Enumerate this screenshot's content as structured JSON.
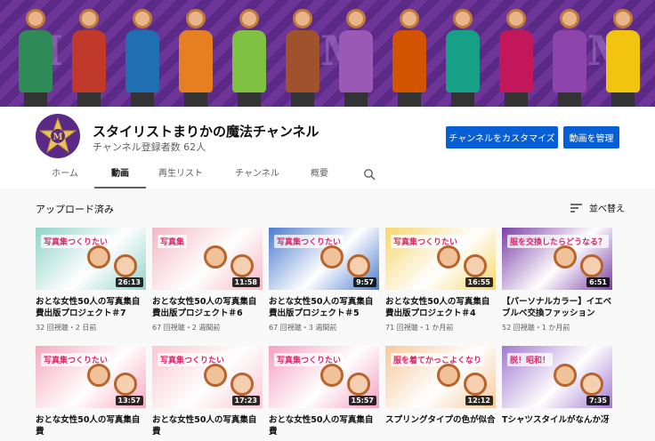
{
  "channel": {
    "name": "スタイリストまりかの魔法チャンネル",
    "subscribers": "チャンネル登録者数 62人",
    "buttons": {
      "customize": "チャンネルをカスタマイズ",
      "manage": "動画を管理"
    }
  },
  "tabs": [
    {
      "label": "ホーム",
      "active": false
    },
    {
      "label": "動画",
      "active": true
    },
    {
      "label": "再生リスト",
      "active": false
    },
    {
      "label": "チャンネル",
      "active": false
    },
    {
      "label": "概要",
      "active": false
    }
  ],
  "section": {
    "title": "アップロード済み",
    "sort_label": "並べ替え"
  },
  "videos": [
    {
      "title": "おとな女性50人の写真集自費出版プロジェクト＃7",
      "meta": "32 回視聴・2 日前",
      "duration": "26:13",
      "thumb_text": "写真集つくりたい",
      "color": "#8fd4c8"
    },
    {
      "title": "おとな女性50人の写真集自費出版プロジェクト＃6",
      "meta": "67 回視聴・2 週間前",
      "duration": "11:58",
      "thumb_text": "写真集",
      "color": "#f4b7c4"
    },
    {
      "title": "おとな女性50人の写真集自費出版プロジェクト＃5",
      "meta": "67 回視聴・3 週間前",
      "duration": "9:57",
      "thumb_text": "写真集つくりたい",
      "color": "#4c7bd0"
    },
    {
      "title": "おとな女性50人の写真集自費出版プロジェクト＃4",
      "meta": "71 回視聴・1 か月前",
      "duration": "16:55",
      "thumb_text": "写真集つくりたい",
      "color": "#f7d76b"
    },
    {
      "title": "【パーソナルカラー】イエベブルベ交換ファッション",
      "meta": "52 回視聴・1 か月前",
      "duration": "6:51",
      "thumb_text": "服を交換したらどうなる？",
      "color": "#7b3fa8"
    },
    {
      "title": "おとな女性50人の写真集自費",
      "meta": "",
      "duration": "13:57",
      "thumb_text": "写真集つくりたい",
      "color": "#f6a9bf"
    },
    {
      "title": "おとな女性50人の写真集自費",
      "meta": "",
      "duration": "17:23",
      "thumb_text": "写真集つくりたい",
      "color": "#f9c7d2"
    },
    {
      "title": "おとな女性50人の写真集自費",
      "meta": "",
      "duration": "15:57",
      "thumb_text": "写真集つくりたい",
      "color": "#f6a0c0"
    },
    {
      "title": "スプリングタイプの色が似合",
      "meta": "",
      "duration": "12:12",
      "thumb_text": "服を着てかっこよくなり",
      "color": "#f5c99b"
    },
    {
      "title": "Tシャツスタイルがなんか冴",
      "meta": "",
      "duration": "7:35",
      "thumb_text": "脱！昭和！",
      "color": "#a07ad0"
    }
  ],
  "colors": {
    "accent": "#065fd4",
    "banner": "#5b2a86"
  }
}
